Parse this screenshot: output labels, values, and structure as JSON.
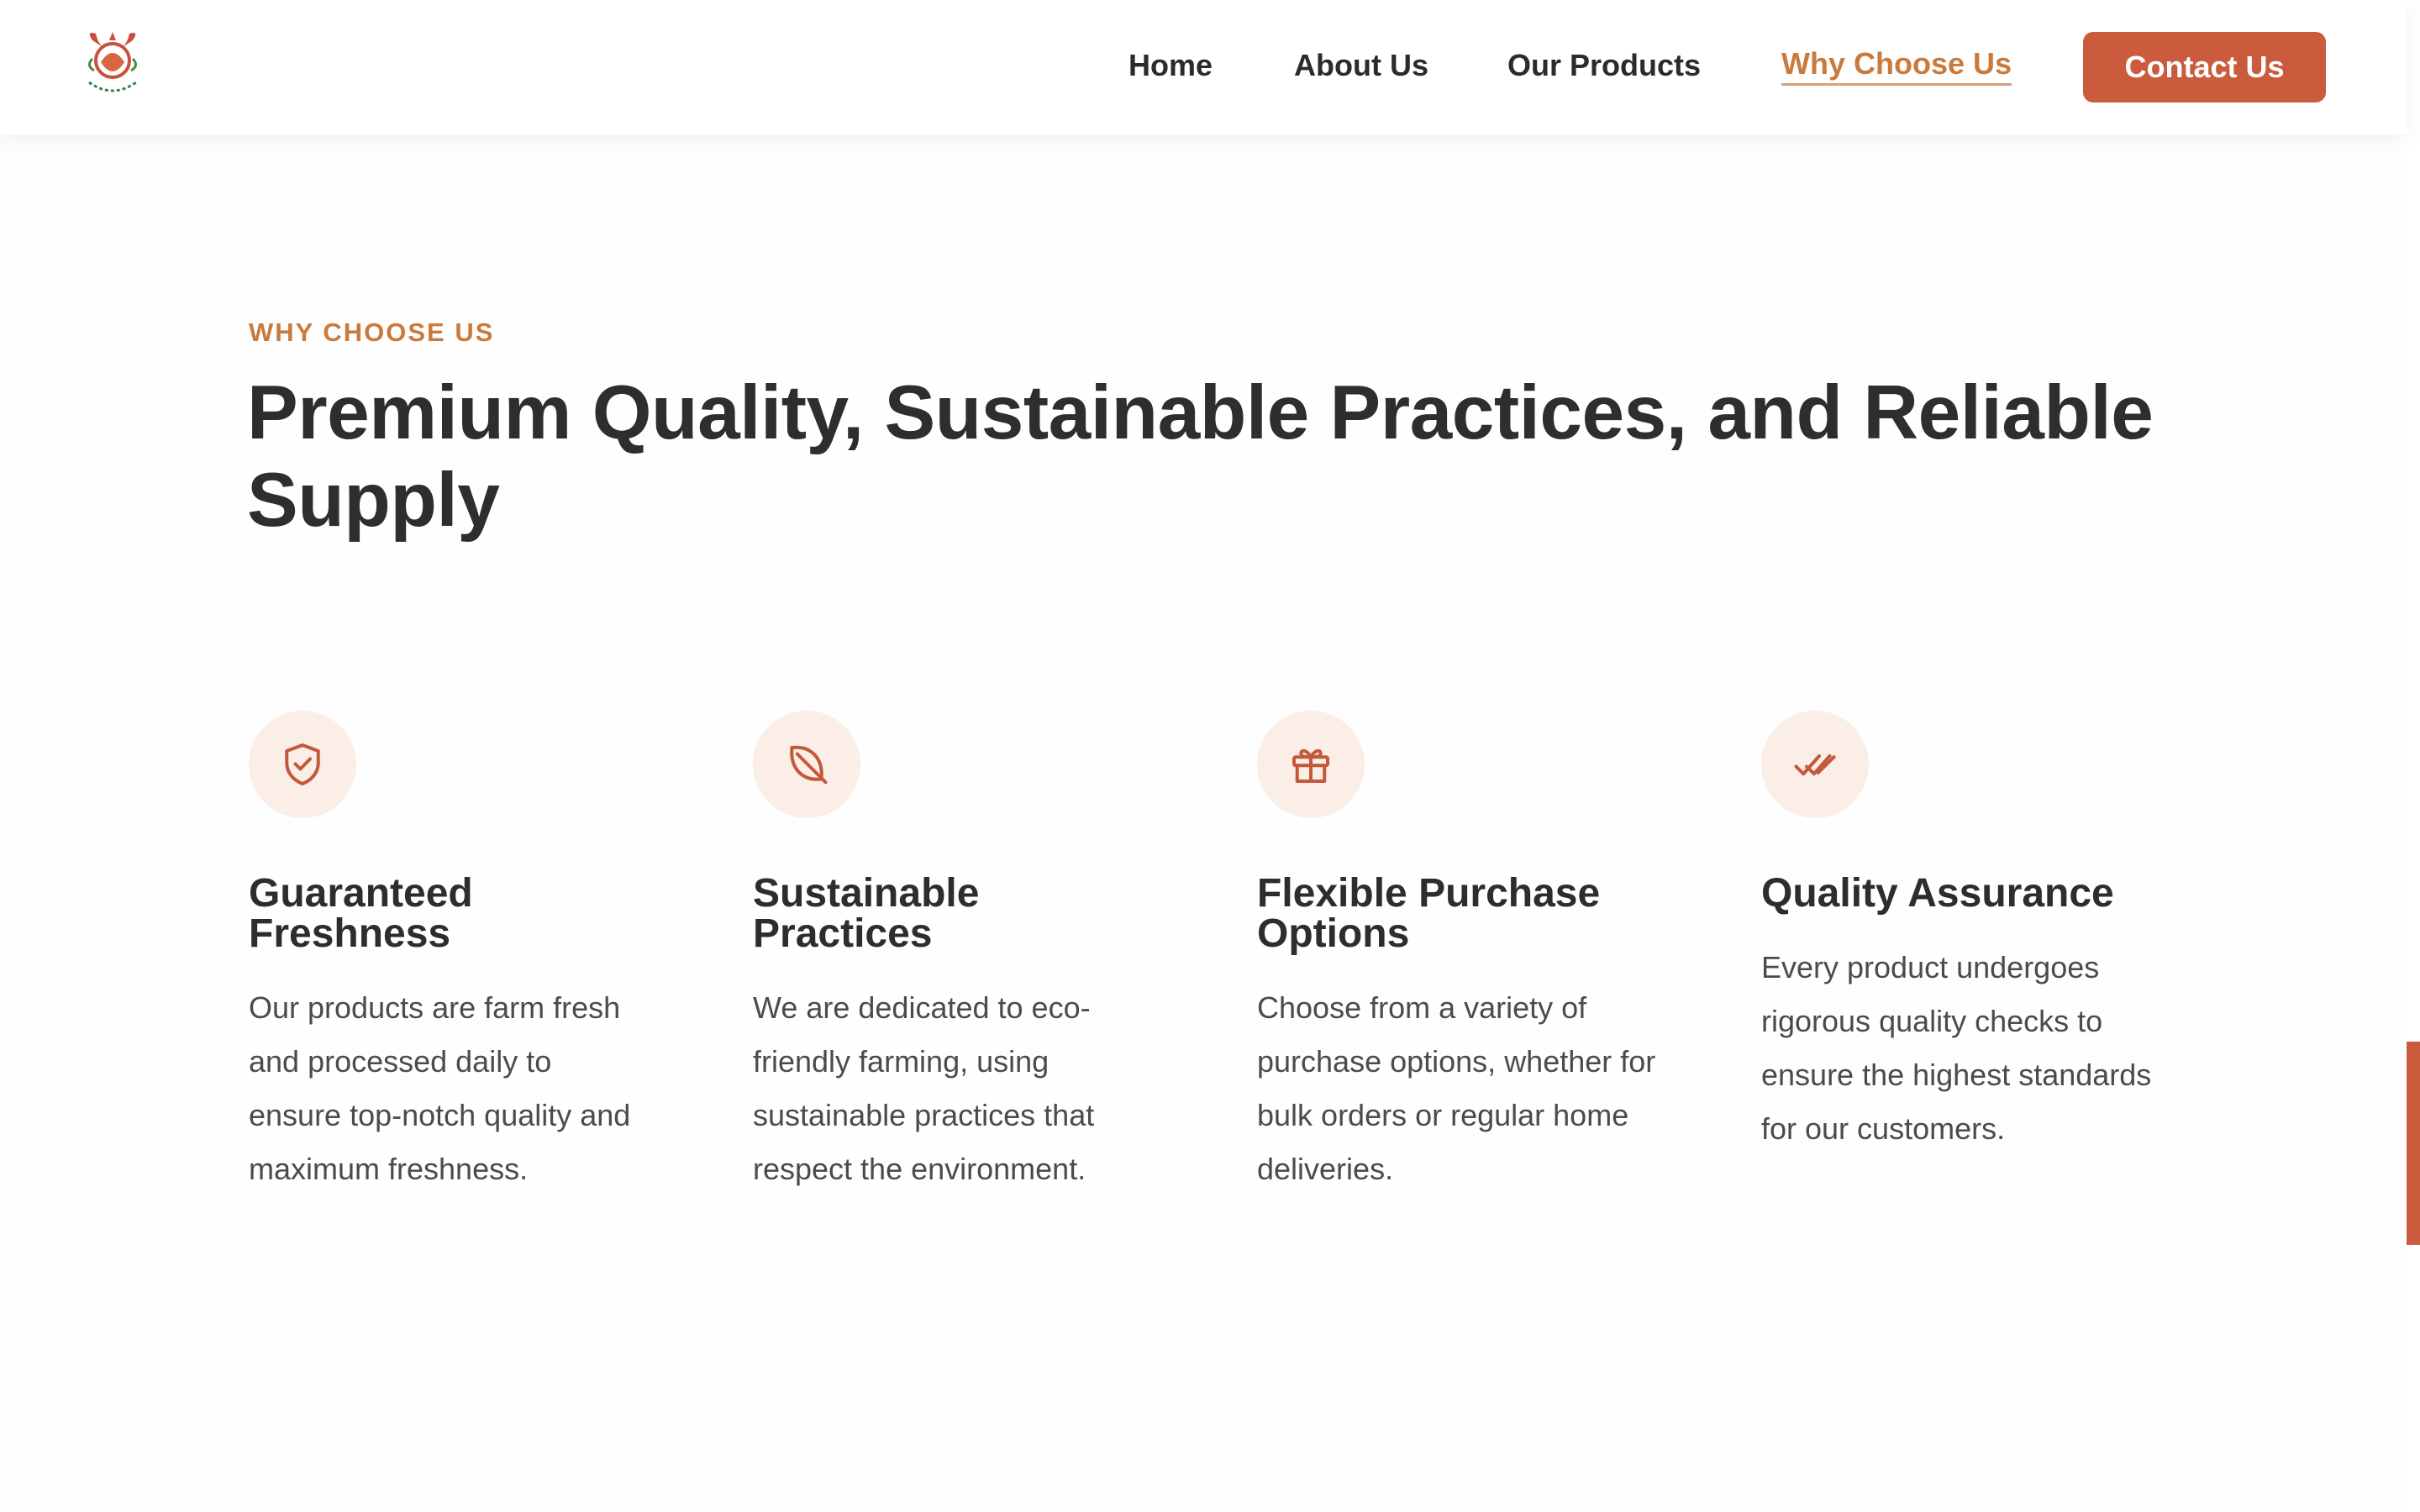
{
  "header": {
    "nav": [
      {
        "label": "Home"
      },
      {
        "label": "About Us"
      },
      {
        "label": "Our Products"
      },
      {
        "label": "Why Choose Us",
        "active": true
      }
    ],
    "cta_label": "Contact Us"
  },
  "section": {
    "eyebrow": "WHY CHOOSE US",
    "headline": "Premium Quality, Sustainable Practices, and Reliable Supply"
  },
  "features": [
    {
      "icon": "shield-check-icon",
      "title": "Guaranteed Freshness",
      "description": "Our products are farm fresh and processed daily to ensure top-notch quality and maximum freshness."
    },
    {
      "icon": "leaf-icon",
      "title": "Sustainable Practices",
      "description": "We are dedicated to eco-friendly farming, using sustainable practices that respect the environment."
    },
    {
      "icon": "gift-icon",
      "title": "Flexible Purchase Options",
      "description": "Choose from a variety of purchase options, whether for bulk orders or regular home deliveries."
    },
    {
      "icon": "double-check-icon",
      "title": "Quality Assurance",
      "description": "Every product undergoes rigorous quality checks to ensure the highest standards for our customers."
    }
  ],
  "colors": {
    "accent": "#ca5c3d",
    "eyebrow": "#c97a3c",
    "icon_bg": "#fbeee6",
    "heading": "#2d2d2d",
    "body_text": "#4b4b4b"
  }
}
